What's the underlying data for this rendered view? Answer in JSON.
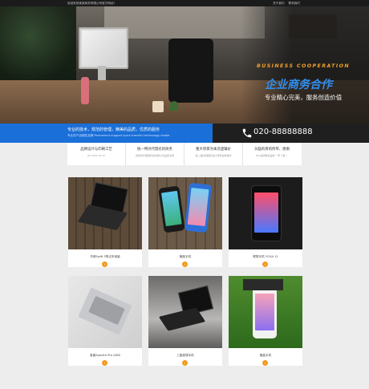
{
  "topbar": {
    "welcome": "欢迎来到某某商务有限公司官方网站!",
    "links": [
      "关于我们",
      "联系我们"
    ]
  },
  "hero": {
    "slide_en": "BUSINESS COOPERATION",
    "slide_cn": "企业商务合作",
    "slide_sub": "专业精心完美，服务创造价值"
  },
  "band": {
    "line1": "专业的技术，规范的管理，精美的品质，优质的服务",
    "line2": "专业的产品磁性品牌 Permanent magnet quick transfer technology leader",
    "phone": "020-88888888"
  },
  "features": [
    {
      "title": "品牌设计与印刷工艺",
      "sub": "HP CPk1.00 TT"
    },
    {
      "title": "统一特许代理名的商务",
      "sub": "完整的代理销售和资质以及品牌全球"
    },
    {
      "title": "重大项目为本次逻辑价",
      "sub": "第二届中国国际进口博览会参展商"
    },
    {
      "title": "头脑的目的所带，感谢",
      "sub": "SKY品牌服务品质 一带一路 丨"
    }
  ],
  "products": [
    {
      "caption": "华硕Swift 5笔记本电脑"
    },
    {
      "caption": "魅族手机"
    },
    {
      "caption": "联想手机 YOGA 11"
    },
    {
      "caption": "惠普Spectre Pro x360"
    },
    {
      "caption": "三星超薄手机"
    },
    {
      "caption": "魅蓝手机"
    }
  ],
  "colors": {
    "accent_blue": "#1a6fd8",
    "accent_orange": "#f39a1e",
    "dark": "#1f1f1f"
  },
  "icons": {
    "phone": "phone-icon",
    "go": "arrow-right-icon"
  }
}
